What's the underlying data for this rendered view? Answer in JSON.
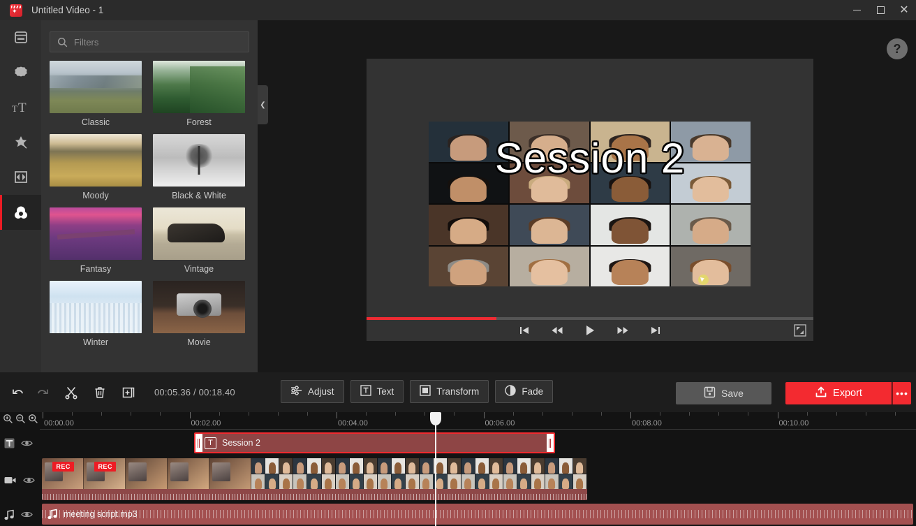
{
  "window": {
    "title": "Untitled Video - 1",
    "app_icon": "clapperboard-icon",
    "minimize": "minimize-icon",
    "maximize": "maximize-icon",
    "close": "close-icon"
  },
  "sidebar": {
    "items": [
      {
        "icon": "media-library-icon",
        "name": "media",
        "active": false
      },
      {
        "icon": "sticker-icon",
        "name": "stickers",
        "active": false
      },
      {
        "icon": "text-icon",
        "name": "text",
        "active": false
      },
      {
        "icon": "effects-wand-icon",
        "name": "effects",
        "active": false
      },
      {
        "icon": "transitions-icon",
        "name": "transitions",
        "active": false
      },
      {
        "icon": "filters-icon",
        "name": "filters",
        "active": true
      }
    ],
    "accent_color": "#ec1c24"
  },
  "panel": {
    "search": {
      "value": "",
      "placeholder": "Filters",
      "icon": "search-icon"
    },
    "collapse_icon": "chevron-left-icon",
    "filters": [
      {
        "label": "Classic",
        "art": "t-classic"
      },
      {
        "label": "Forest",
        "art": "t-forest"
      },
      {
        "label": "Moody",
        "art": "t-moody"
      },
      {
        "label": "Black & White",
        "art": "t-bw"
      },
      {
        "label": "Fantasy",
        "art": "t-fantasy"
      },
      {
        "label": "Vintage",
        "art": "t-vintage"
      },
      {
        "label": "Winter",
        "art": "t-winter"
      },
      {
        "label": "Movie",
        "art": "t-movie"
      }
    ]
  },
  "preview": {
    "help_label": "?",
    "overlay_text": "Session 2",
    "progress_percent": 29,
    "controls": [
      {
        "name": "skip-to-start-button",
        "icon": "skip-start-icon"
      },
      {
        "name": "rewind-button",
        "icon": "rewind-icon"
      },
      {
        "name": "play-button",
        "icon": "play-icon"
      },
      {
        "name": "fast-forward-button",
        "icon": "fast-forward-icon"
      },
      {
        "name": "skip-to-end-button",
        "icon": "skip-end-icon"
      }
    ],
    "fullscreen_icon": "fullscreen-icon"
  },
  "actionbar": {
    "undo_icon": "undo-icon",
    "redo_icon": "redo-icon",
    "split_icon": "scissors-icon",
    "delete_icon": "trash-icon",
    "duplicate_icon": "duplicate-icon",
    "timecode": "00:05.36 / 00:18.40",
    "tools": [
      {
        "label": "Adjust",
        "icon": "sliders-icon"
      },
      {
        "label": "Text",
        "icon": "text-box-icon"
      },
      {
        "label": "Transform",
        "icon": "transform-icon"
      },
      {
        "label": "Fade",
        "icon": "fade-icon"
      }
    ],
    "save_label": "Save",
    "save_icon": "save-icon",
    "export_label": "Export",
    "export_icon": "upload-icon",
    "export_more_label": "•••",
    "export_color": "#f32a30"
  },
  "timeline": {
    "zoom_in_icon": "zoom-in-icon",
    "zoom_out_icon": "zoom-out-icon",
    "zoom_fit_icon": "zoom-fit-icon",
    "ruler_labels": [
      "00:00.00",
      "00:02.00",
      "00:04.00",
      "00:06.00",
      "00:08.00",
      "00:10.00"
    ],
    "playhead_position": "00:05.36",
    "tracks": [
      {
        "name": "text-track",
        "icon": "text-track-icon",
        "eye_icon": "eye-icon",
        "clip": {
          "label": "Session 2",
          "icon": "text-clip-icon",
          "selected": true
        }
      },
      {
        "name": "video-track",
        "icon": "video-track-icon",
        "eye_icon": "eye-icon",
        "clip": {
          "label": "",
          "badge": "REC"
        }
      },
      {
        "name": "audio-track",
        "icon": "audio-track-icon",
        "eye_icon": "eye-icon",
        "clip": {
          "label": "meeting script.mp3",
          "icon": "music-note-icon"
        }
      }
    ]
  }
}
